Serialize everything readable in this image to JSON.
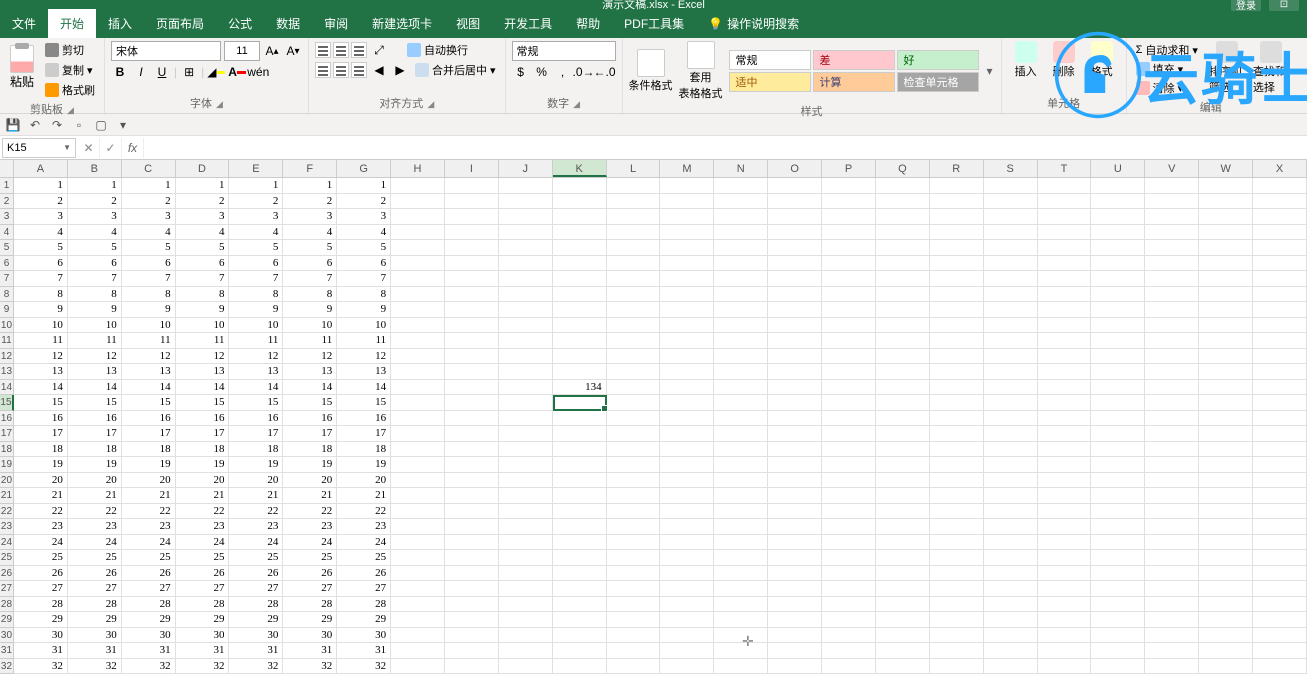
{
  "title": "演示文稿.xlsx - Excel",
  "title_login": "登录",
  "tabs": [
    "文件",
    "开始",
    "插入",
    "页面布局",
    "公式",
    "数据",
    "审阅",
    "新建选项卡",
    "视图",
    "开发工具",
    "帮助",
    "PDF工具集"
  ],
  "active_tab_index": 1,
  "tell_me": "操作说明搜索",
  "ribbon": {
    "clipboard": {
      "paste": "粘贴",
      "cut": "剪切",
      "copy": "复制",
      "format_painter": "格式刷",
      "label": "剪贴板"
    },
    "font": {
      "name": "宋体",
      "size": "11",
      "label": "字体"
    },
    "align": {
      "wrap": "自动换行",
      "merge": "合并后居中",
      "label": "对齐方式"
    },
    "number": {
      "format": "常规",
      "label": "数字"
    },
    "styles": {
      "cond": "条件格式",
      "table": "套用\n表格格式",
      "normal": "常规",
      "bad": "差",
      "good": "好",
      "warn": "适中",
      "calc": "计算",
      "check": "检查单元格",
      "label": "样式"
    },
    "cells": {
      "insert": "插入",
      "delete": "删除",
      "format": "格式",
      "label": "单元格"
    },
    "editing": {
      "autosum": "自动求和",
      "fill": "填充",
      "clear": "清除",
      "sort": "排序和筛选",
      "find": "查找和选择",
      "label": "编辑"
    }
  },
  "name_box": "K15",
  "formula": "",
  "columns": [
    "A",
    "B",
    "C",
    "D",
    "E",
    "F",
    "G",
    "H",
    "I",
    "J",
    "K",
    "L",
    "M",
    "N",
    "O",
    "P",
    "Q",
    "R",
    "S",
    "T",
    "U",
    "V",
    "W",
    "X"
  ],
  "selected_col_index": 10,
  "selected_row_index": 14,
  "k14_value": "134",
  "data_fill_cols": 7,
  "data_fill_rows": 32,
  "watermark": "云骑士"
}
